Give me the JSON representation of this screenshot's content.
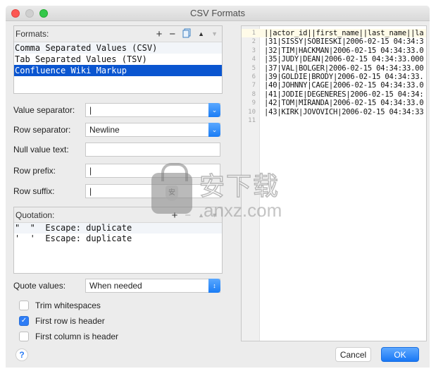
{
  "window": {
    "title": "CSV Formats"
  },
  "formats": {
    "header": "Formats:",
    "toolbar": {
      "add_icon": "+",
      "remove_icon": "−",
      "copy_icon": "copy-icon",
      "move_up_icon": "▲",
      "move_down_icon": "▼"
    },
    "items": [
      {
        "label": "Comma Separated Values (CSV)",
        "selected": false
      },
      {
        "label": "Tab Separated Values (TSV)",
        "selected": false
      },
      {
        "label": "Confluence Wiki Markup",
        "selected": true
      }
    ]
  },
  "form": {
    "value_separator": {
      "label": "Value separator:",
      "value": "|"
    },
    "row_separator": {
      "label": "Row separator:",
      "value": "Newline"
    },
    "null_value_text": {
      "label": "Null value text:",
      "value": ""
    },
    "row_prefix": {
      "label": "Row prefix:",
      "value": "|"
    },
    "row_suffix": {
      "label": "Row suffix:",
      "value": "|"
    }
  },
  "quotation": {
    "header": "Quotation:",
    "toolbar": {
      "add_icon": "+",
      "remove_icon": "−",
      "up_icon": "▲",
      "down_icon": "▼"
    },
    "items": [
      {
        "text": "\"  \"  Escape: duplicate"
      },
      {
        "text": "'  '  Escape: duplicate"
      }
    ]
  },
  "quote_values": {
    "label": "Quote values:",
    "value": "When needed"
  },
  "checkboxes": [
    {
      "label": "Trim whitespaces",
      "checked": false
    },
    {
      "label": "First row is header",
      "checked": true
    },
    {
      "label": "First column is header",
      "checked": false
    }
  ],
  "buttons": {
    "help": "?",
    "cancel": "Cancel",
    "ok": "OK"
  },
  "preview": {
    "lines": [
      {
        "num": "1",
        "text": "||actor_id||first_name||last_name||la"
      },
      {
        "num": "2",
        "text": "|31|SISSY|SOBIESKI|2006-02-15 04:34:3"
      },
      {
        "num": "3",
        "text": "|32|TIM|HACKMAN|2006-02-15 04:34:33.0"
      },
      {
        "num": "4",
        "text": "|35|JUDY|DEAN|2006-02-15 04:34:33.000"
      },
      {
        "num": "5",
        "text": "|37|VAL|BOLGER|2006-02-15 04:34:33.00"
      },
      {
        "num": "6",
        "text": "|39|GOLDIE|BRODY|2006-02-15 04:34:33."
      },
      {
        "num": "7",
        "text": "|40|JOHNNY|CAGE|2006-02-15 04:34:33.0"
      },
      {
        "num": "8",
        "text": "|41|JODIE|DEGENERES|2006-02-15 04:34:"
      },
      {
        "num": "9",
        "text": "|42|TOM|MIRANDA|2006-02-15 04:34:33.0"
      },
      {
        "num": "10",
        "text": "|43|KIRK|JOVOVICH|2006-02-15 04:34:33"
      },
      {
        "num": "11",
        "text": ""
      }
    ]
  },
  "watermark": {
    "cn_text": "安下载",
    "en_text": "anxz.com",
    "shield_glyph": "安"
  }
}
